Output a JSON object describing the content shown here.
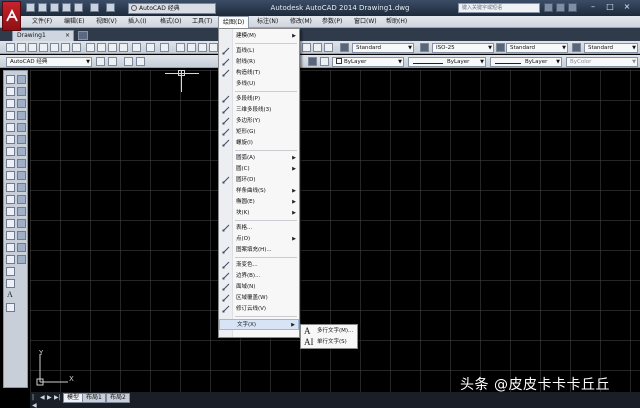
{
  "window": {
    "title": "Autodesk AutoCAD 2014    Drawing1.dwg",
    "workspace": "AutoCAD 经典",
    "search_placeholder": "键入关键字或短语"
  },
  "menubar": {
    "items": [
      "文件(F)",
      "编辑(E)",
      "视图(V)",
      "插入(I)",
      "格式(O)",
      "工具(T)",
      "绘图(D)",
      "标注(N)",
      "修改(M)",
      "参数(P)",
      "窗口(W)",
      "帮助(H)"
    ],
    "active_index": 6
  },
  "tabs": {
    "document": "Drawing1"
  },
  "toolbars": {
    "text_style": "Standard",
    "dim_style": "ISO-25",
    "table_style": "Standard",
    "mleader_style": "Standard",
    "workspace2": "AutoCAD 经典",
    "color": "ByLayer",
    "linetype": "ByLayer",
    "lineweight": "ByLayer",
    "plotstyle": "ByColor"
  },
  "draw_menu": {
    "items": [
      {
        "label": "建模(M)",
        "icon": "",
        "submenu": true
      },
      {
        "sep": true
      },
      {
        "label": "直线(L)",
        "icon": "line-icon"
      },
      {
        "label": "射线(R)",
        "icon": "ray-icon"
      },
      {
        "label": "构造线(T)",
        "icon": "xline-icon"
      },
      {
        "label": "多线(U)",
        "icon": ""
      },
      {
        "sep": true
      },
      {
        "label": "多段线(P)",
        "icon": "polyline-icon"
      },
      {
        "label": "三维多段线(3)",
        "icon": "3dpolyline-icon"
      },
      {
        "label": "多边形(Y)",
        "icon": "polygon-icon"
      },
      {
        "label": "矩形(G)",
        "icon": "rectangle-icon"
      },
      {
        "label": "螺旋(I)",
        "icon": "helix-icon"
      },
      {
        "sep": true
      },
      {
        "label": "圆弧(A)",
        "icon": "",
        "submenu": true
      },
      {
        "label": "圆(C)",
        "icon": "",
        "submenu": true
      },
      {
        "label": "圆环(D)",
        "icon": "donut-icon"
      },
      {
        "label": "样条曲线(S)",
        "icon": "",
        "submenu": true
      },
      {
        "label": "椭圆(E)",
        "icon": "",
        "submenu": true
      },
      {
        "label": "块(K)",
        "icon": "",
        "submenu": true
      },
      {
        "sep": true
      },
      {
        "label": "表格...",
        "icon": "table-icon"
      },
      {
        "label": "点(O)",
        "icon": "",
        "submenu": true
      },
      {
        "label": "图案填充(H)...",
        "icon": "hatch-icon"
      },
      {
        "sep": true
      },
      {
        "label": "渐变色...",
        "icon": "gradient-icon"
      },
      {
        "label": "边界(B)...",
        "icon": "boundary-icon"
      },
      {
        "label": "面域(N)",
        "icon": "region-icon"
      },
      {
        "label": "区域覆盖(W)",
        "icon": "wipeout-icon"
      },
      {
        "label": "修订云线(V)",
        "icon": "revcloud-icon"
      },
      {
        "sep": true
      },
      {
        "label": "文字(X)",
        "icon": "",
        "submenu": true,
        "hover": true
      }
    ]
  },
  "text_submenu": {
    "items": [
      {
        "label": "多行文字(M)...",
        "icon": "A"
      },
      {
        "label": "单行文字(S)",
        "icon": "AI"
      }
    ]
  },
  "layout_tabs": [
    "模型",
    "布局1",
    "布局2"
  ],
  "ucs": {
    "y": "Y",
    "x": "X"
  },
  "watermark": "头条 @皮皮卡卡卡丘丘"
}
